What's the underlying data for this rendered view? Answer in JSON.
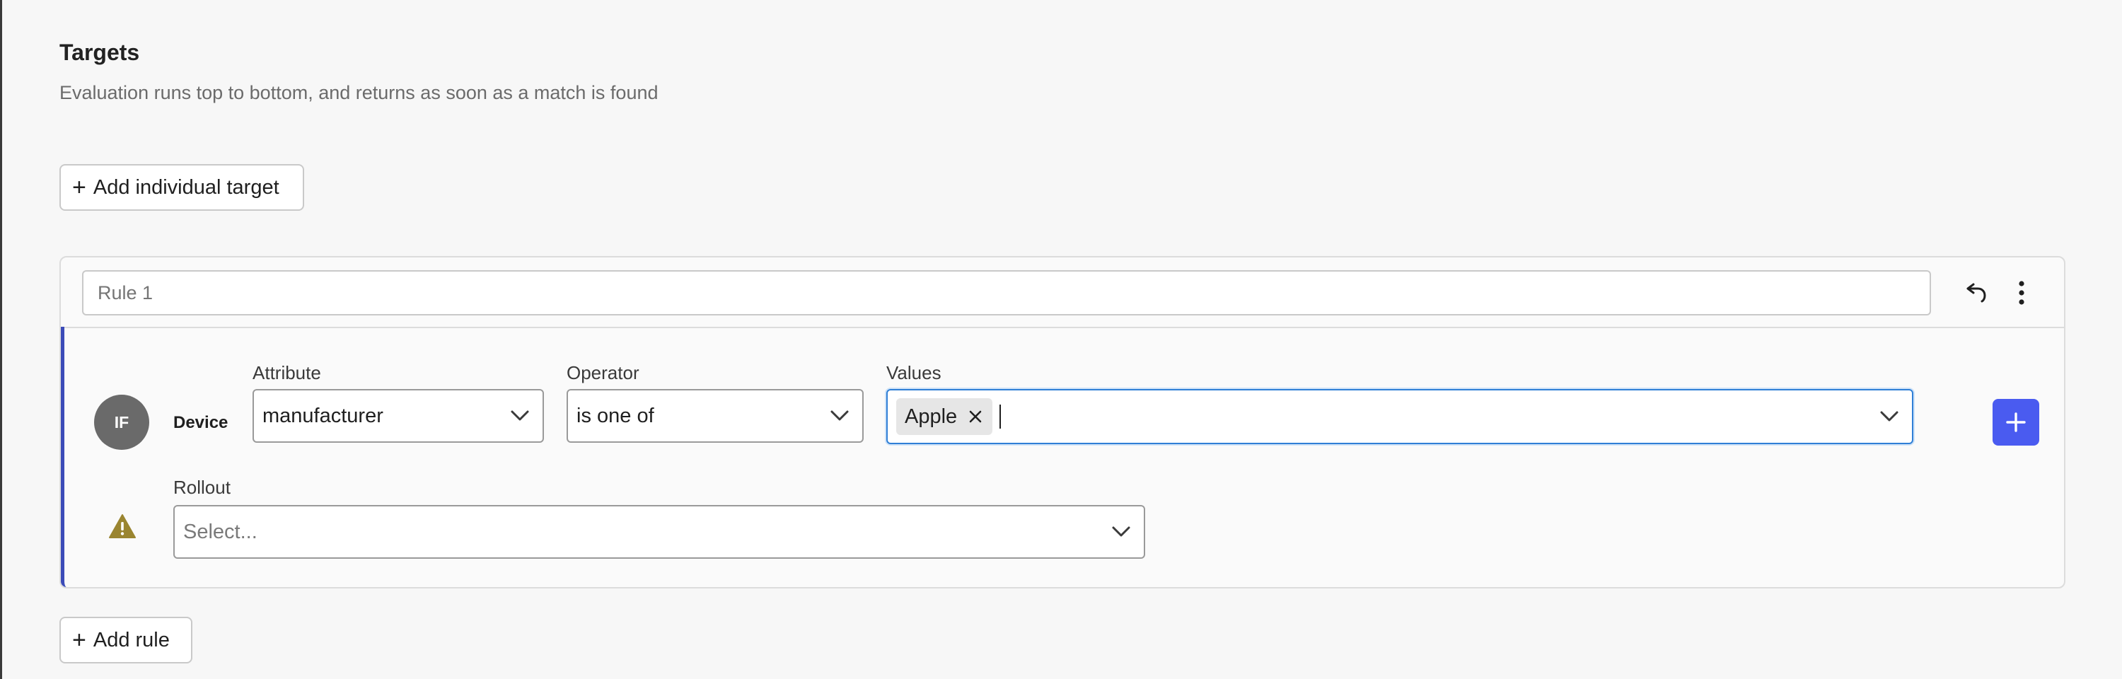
{
  "targets": {
    "title": "Targets",
    "subtitle": "Evaluation runs top to bottom, and returns as soon as a match is found",
    "add_individual_target_label": "Add individual target",
    "add_rule_label": "Add rule"
  },
  "rule": {
    "name_placeholder": "Rule 1",
    "if_badge": "IF",
    "context_kind": "Device",
    "attribute_label": "Attribute",
    "attribute_value": "manufacturer",
    "operator_label": "Operator",
    "operator_value": "is one of",
    "values_label": "Values",
    "values": [
      "Apple"
    ],
    "rollout_label": "Rollout",
    "rollout_placeholder": "Select..."
  },
  "icons": {
    "undo": "undo-icon",
    "more": "more-vertical-icon",
    "remove_chip": "close-icon",
    "chevron": "chevron-down-icon",
    "add": "plus-icon",
    "warning": "warning-icon"
  },
  "colors": {
    "accent": "#4a5bf0",
    "rule_border": "#3b4bb8",
    "focus_border": "#2f7fd6",
    "warning": "#9a8530"
  }
}
